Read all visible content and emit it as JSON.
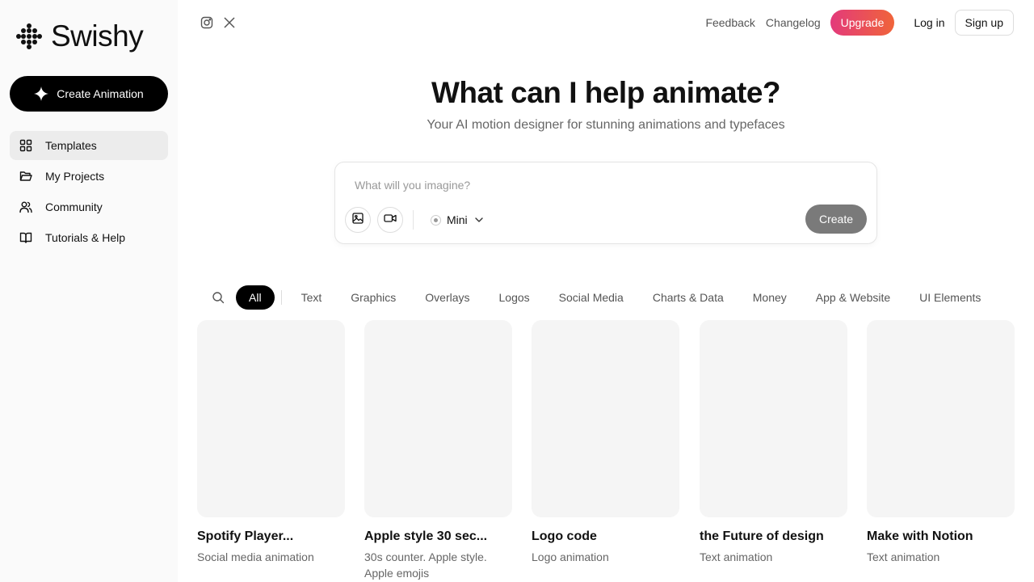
{
  "brand": {
    "name": "Swishy"
  },
  "sidebar": {
    "create_label": "Create Animation",
    "items": [
      {
        "label": "Templates",
        "icon": "grid-icon",
        "active": true
      },
      {
        "label": "My Projects",
        "icon": "folder-open-icon"
      },
      {
        "label": "Community",
        "icon": "users-icon"
      },
      {
        "label": "Tutorials & Help",
        "icon": "book-icon"
      }
    ]
  },
  "header": {
    "social": [
      "instagram-icon",
      "x-icon"
    ],
    "feedback": "Feedback",
    "changelog": "Changelog",
    "upgrade": "Upgrade",
    "login": "Log in",
    "signup": "Sign up"
  },
  "hero": {
    "title": "What can I help animate?",
    "subtitle": "Your AI motion designer for stunning animations and typefaces"
  },
  "prompt": {
    "placeholder": "What will you imagine?",
    "model": "Mini",
    "create_label": "Create"
  },
  "filters": [
    "All",
    "Text",
    "Graphics",
    "Overlays",
    "Logos",
    "Social Media",
    "Charts & Data",
    "Money",
    "App & Website",
    "UI Elements"
  ],
  "cards": [
    {
      "title": "Spotify Player...",
      "desc": "Social media animation"
    },
    {
      "title": "Apple style 30 sec...",
      "desc": "30s counter. Apple style. Apple emojis"
    },
    {
      "title": "Logo code",
      "desc": "Logo animation"
    },
    {
      "title": "the Future of design",
      "desc": "Text animation"
    },
    {
      "title": "Make with Notion",
      "desc": "Text animation"
    }
  ],
  "colors": {
    "accent_start": "#e33a7b",
    "accent_end": "#f0643a",
    "primary": "#000000",
    "card_bg": "#f5f5f5"
  }
}
